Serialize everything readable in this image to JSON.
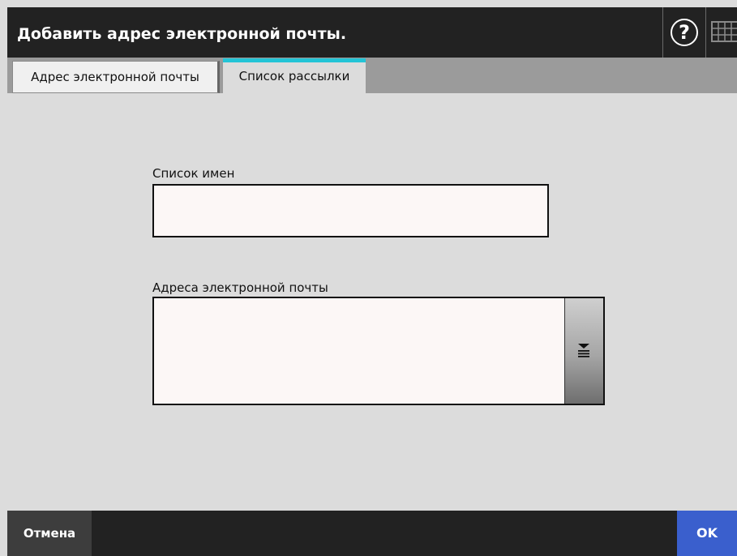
{
  "header": {
    "title": "Добавить адрес электронной почты.",
    "help_icon": "help-icon",
    "keyboard_icon": "keyboard-icon"
  },
  "tabs": [
    {
      "label": "Адрес электронной почты",
      "active": false
    },
    {
      "label": "Список рассылки",
      "active": true
    }
  ],
  "form": {
    "names_label": "Список имен",
    "names_value": "",
    "addresses_label": "Адреса электронной почты",
    "addresses_value": "",
    "expand_icon": "expand-list-icon"
  },
  "footer": {
    "cancel_label": "Отмена",
    "ok_label": "OK"
  },
  "colors": {
    "header_bg": "#222222",
    "active_tab_accent": "#23c4d6",
    "ok_button": "#3a5fcd",
    "content_bg": "#dcdcdc"
  }
}
